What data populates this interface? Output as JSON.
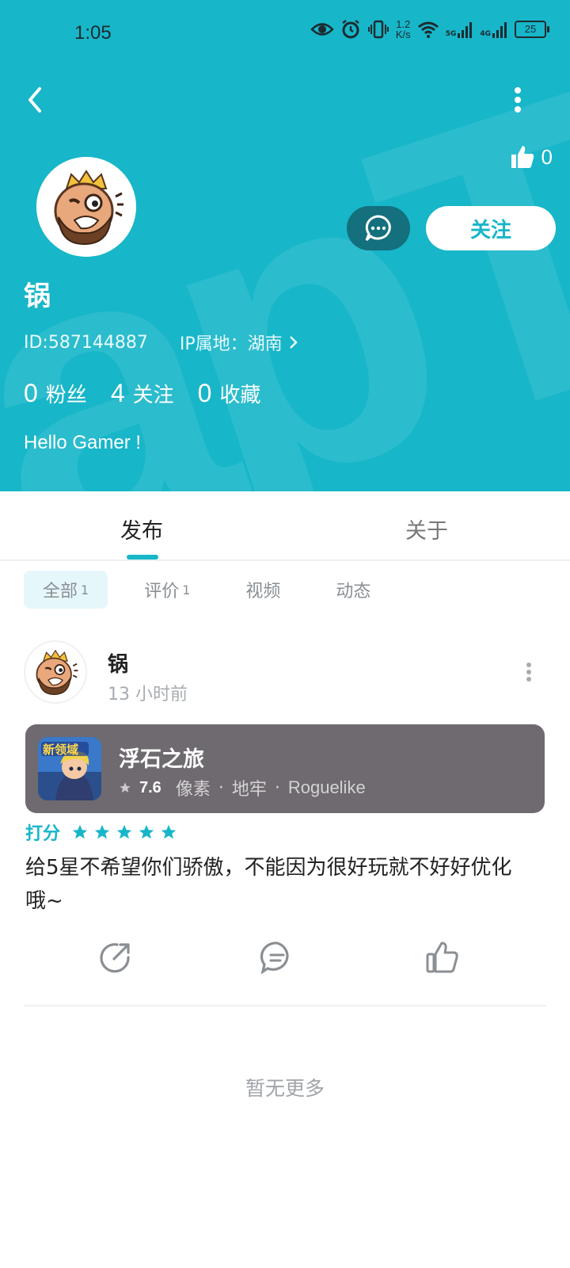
{
  "status_bar": {
    "time": "1:05",
    "net_speed_value": "1.2",
    "net_speed_unit": "K/s",
    "battery": "25",
    "signal_1": "5G",
    "signal_2": "4G"
  },
  "profile": {
    "likes_count": "0",
    "follow_label": "关注",
    "name": "锅",
    "id_text": "ID:587144887",
    "ip_text": "IP属地：湖南",
    "stats": [
      {
        "num": "0",
        "label": "粉丝"
      },
      {
        "num": "4",
        "label": "关注"
      },
      {
        "num": "0",
        "label": "收藏"
      }
    ],
    "bio": "Hello Gamer !"
  },
  "tabs": [
    {
      "label": "发布"
    },
    {
      "label": "关于"
    }
  ],
  "chips": [
    {
      "label": "全部",
      "count": "1"
    },
    {
      "label": "评价",
      "count": "1"
    },
    {
      "label": "视频",
      "count": ""
    },
    {
      "label": "动态",
      "count": ""
    }
  ],
  "post": {
    "author": "锅",
    "time": "13 小时前",
    "game": {
      "name": "浮石之旅",
      "score": "7.6",
      "tags": [
        "像素",
        "地牢",
        "Roguelike"
      ],
      "icon_text": "新领域"
    },
    "rating_label": "打分",
    "rating": 5,
    "review": "给5星不希望你们骄傲，不能因为很好玩就不好好优化哦~"
  },
  "no_more": "暂无更多",
  "colors": {
    "accent": "#17b6c9",
    "game_card": "#6f6a70"
  }
}
